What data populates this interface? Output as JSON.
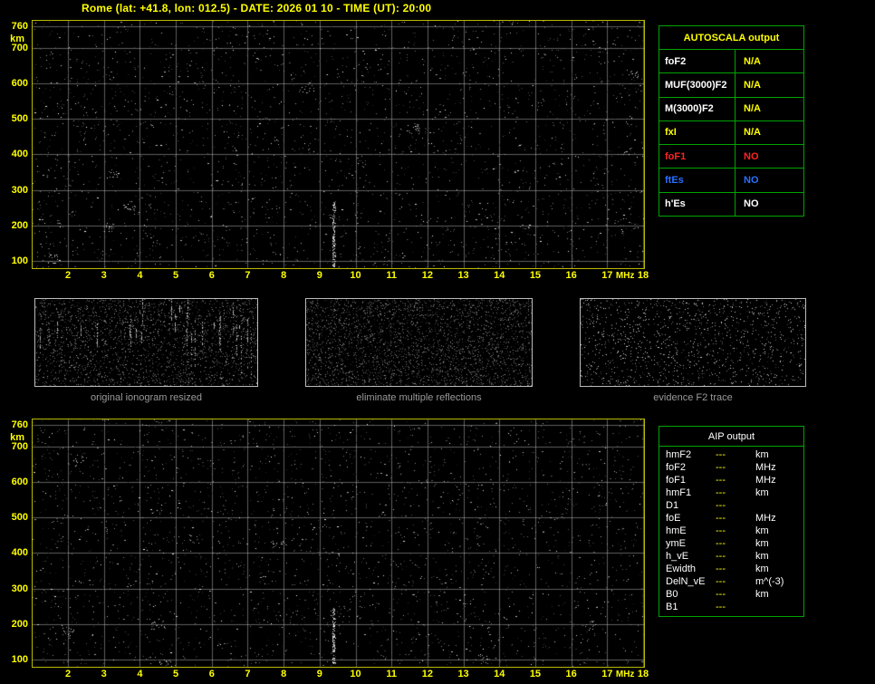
{
  "title": "Rome (lat: +41.8, lon: 012.5) - DATE: 2026 01 10 - TIME (UT): 20:00",
  "colors": {
    "background": "#000000",
    "title": "#ffff00",
    "plot_border": "#b9b900",
    "axis_label": "#ffff00",
    "table_border": "#00a400",
    "caption": "#9a9a9a"
  },
  "ionogram": {
    "y_unit": "km",
    "x_unit": "MHz",
    "y_ticks": [
      760,
      700,
      600,
      500,
      400,
      300,
      200,
      100
    ],
    "x_ticks": [
      2,
      3,
      4,
      5,
      6,
      7,
      8,
      9,
      10,
      11,
      12,
      13,
      14,
      15,
      16,
      17,
      18
    ]
  },
  "autoscala_table": {
    "title": "AUTOSCALA output",
    "rows": [
      {
        "label": "foF2",
        "value": "N/A",
        "label_color": "#ffffff",
        "value_color": "#ffff00"
      },
      {
        "label": "MUF(3000)F2",
        "value": "N/A",
        "label_color": "#ffffff",
        "value_color": "#ffff00"
      },
      {
        "label": "M(3000)F2",
        "value": "N/A",
        "label_color": "#ffffff",
        "value_color": "#ffff00"
      },
      {
        "label": "fxI",
        "value": "N/A",
        "label_color": "#ffff00",
        "value_color": "#ffff00"
      },
      {
        "label": "foF1",
        "value": "NO",
        "label_color": "#ff2222",
        "value_color": "#ff2222"
      },
      {
        "label": "ftEs",
        "value": "NO",
        "label_color": "#2b6fff",
        "value_color": "#2b6fff"
      },
      {
        "label": "h'Es",
        "value": "NO",
        "label_color": "#ffffff",
        "value_color": "#ffffff"
      }
    ]
  },
  "thumbnails": [
    {
      "caption": "original ionogram resized"
    },
    {
      "caption": "eliminate multiple reflections"
    },
    {
      "caption": "evidence F2 trace"
    }
  ],
  "aip_table": {
    "title": "AIP output",
    "rows": [
      {
        "label": "hmF2",
        "value": "---",
        "unit": "km"
      },
      {
        "label": "foF2",
        "value": "---",
        "unit": "MHz"
      },
      {
        "label": "foF1",
        "value": "---",
        "unit": "MHz"
      },
      {
        "label": "hmF1",
        "value": "---",
        "unit": "km"
      },
      {
        "label": "D1",
        "value": "---",
        "unit": ""
      },
      {
        "label": "foE",
        "value": "---",
        "unit": "MHz"
      },
      {
        "label": "hmE",
        "value": "---",
        "unit": "km"
      },
      {
        "label": "ymE",
        "value": "---",
        "unit": "km"
      },
      {
        "label": "h_vE",
        "value": "---",
        "unit": "km"
      },
      {
        "label": "Ewidth",
        "value": "---",
        "unit": "km"
      },
      {
        "label": "DelN_vE",
        "value": "---",
        "unit": "m^(-3)"
      },
      {
        "label": "B0",
        "value": "---",
        "unit": "km"
      },
      {
        "label": "B1",
        "value": "---",
        "unit": ""
      }
    ]
  }
}
